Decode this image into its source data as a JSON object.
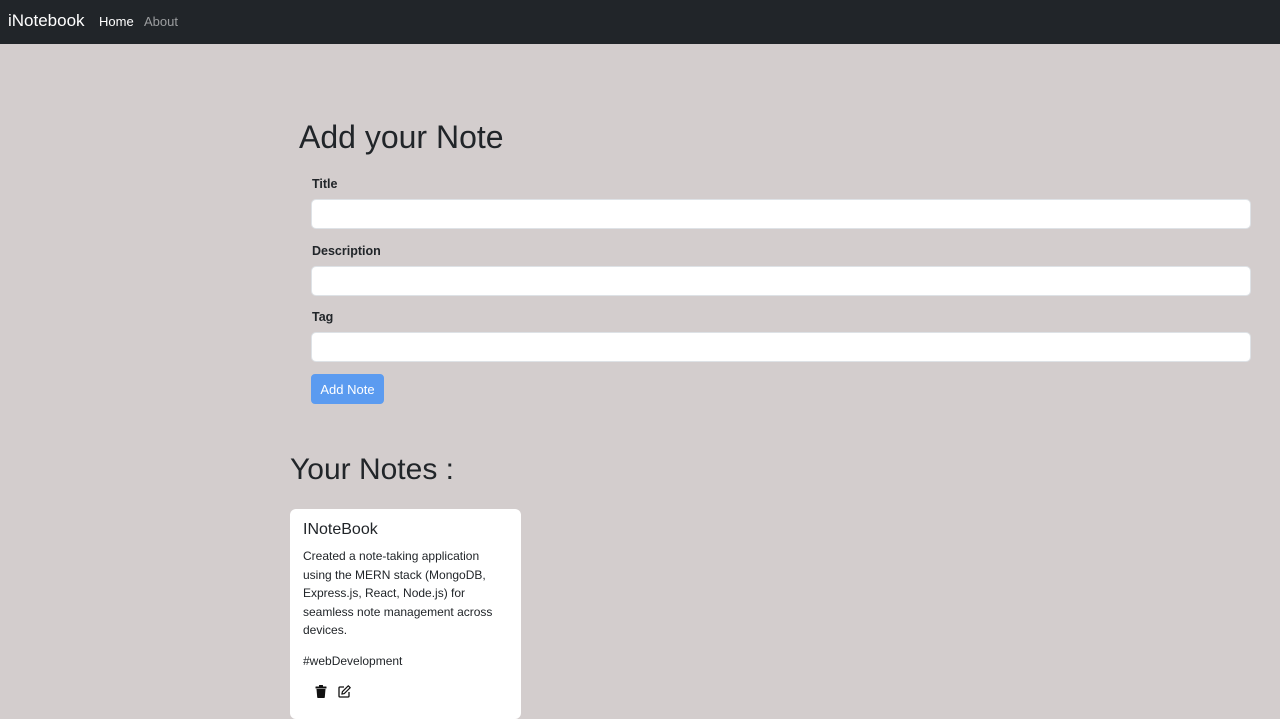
{
  "navbar": {
    "brand": "iNotebook",
    "links": [
      {
        "label": "Home",
        "active": true
      },
      {
        "label": "About",
        "active": false
      }
    ],
    "background": "#212529"
  },
  "add_form": {
    "heading": "Add your Note",
    "fields": [
      {
        "label": "Title",
        "value": "",
        "placeholder": ""
      },
      {
        "label": "Description",
        "value": "",
        "placeholder": ""
      },
      {
        "label": "Tag",
        "value": "",
        "placeholder": ""
      }
    ],
    "submit_label": "Add Note",
    "submit_color": "#5b9bf0"
  },
  "notes_section": {
    "heading": "Your Notes :",
    "notes": [
      {
        "title": "INoteBook",
        "description": "Created a note-taking application using the MERN stack (MongoDB, Express.js, React, Node.js) for seamless note management across devices.",
        "tag": "#webDevelopment",
        "actions": [
          "trash-icon",
          "edit-icon"
        ]
      }
    ]
  },
  "page_background": "#d3cdcd"
}
